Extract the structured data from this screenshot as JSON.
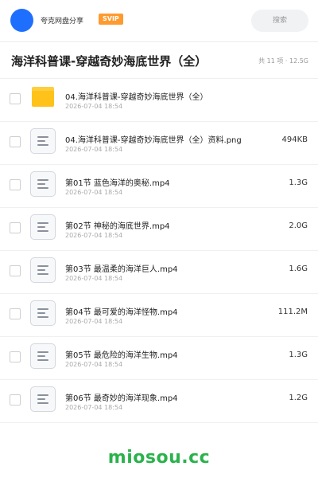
{
  "header": {
    "share_name": "夸克网盘分享",
    "badge": "SVIP",
    "search_placeholder": "搜索"
  },
  "folder": {
    "title": "海洋科普课-穿越奇妙海底世界（全）",
    "summary": "共 11 项 · 12.5G"
  },
  "files": [
    {
      "type": "folder",
      "name": "04.海洋科普课-穿越奇妙海底世界（全）",
      "date": "2026-07-04 18:54",
      "size": ""
    },
    {
      "type": "file",
      "name": "04.海洋科普课-穿越奇妙海底世界（全）资料.png",
      "date": "2026-07-04 18:54",
      "size": "494KB"
    },
    {
      "type": "file",
      "name": "第01节 蓝色海洋的奥秘.mp4",
      "date": "2026-07-04 18:54",
      "size": "1.3G"
    },
    {
      "type": "file",
      "name": "第02节 神秘的海底世界.mp4",
      "date": "2026-07-04 18:54",
      "size": "2.0G"
    },
    {
      "type": "file",
      "name": "第03节 最温柔的海洋巨人.mp4",
      "date": "2026-07-04 18:54",
      "size": "1.6G"
    },
    {
      "type": "file",
      "name": "第04节 最可爱的海洋怪物.mp4",
      "date": "2026-07-04 18:54",
      "size": "111.2M"
    },
    {
      "type": "file",
      "name": "第05节 最危险的海洋生物.mp4",
      "date": "2026-07-04 18:54",
      "size": "1.3G"
    },
    {
      "type": "file",
      "name": "第06节 最奇妙的海洋现象.mp4",
      "date": "2026-07-04 18:54",
      "size": "1.2G"
    }
  ],
  "watermark": "miosou.cc",
  "colors": {
    "accent": "#1f6fff",
    "badge": "#ff9a2e",
    "folder": "#ffc21a",
    "watermark": "#2bb24c"
  }
}
